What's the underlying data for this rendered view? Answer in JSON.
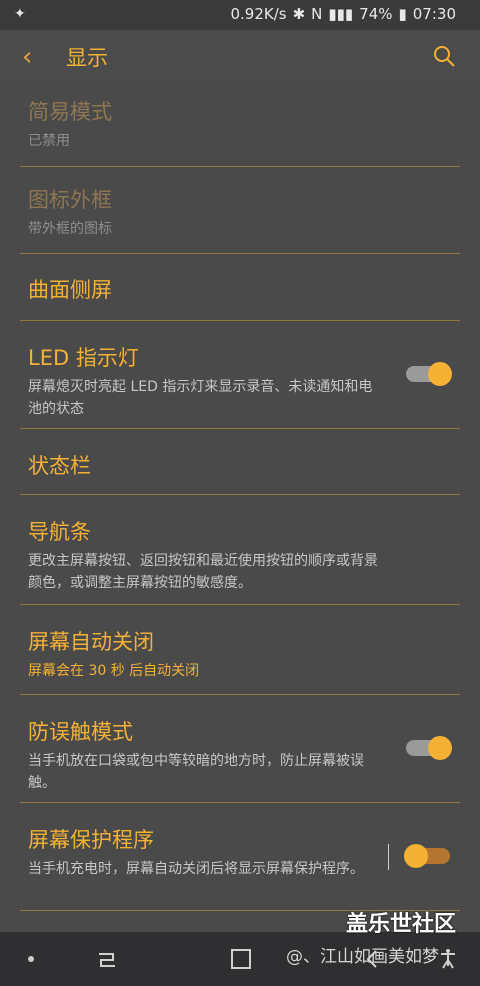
{
  "status_bar": {
    "left_icon": "notification-icon",
    "speed": "0.92K/s",
    "battery": "74%",
    "time": "07:30"
  },
  "app_bar": {
    "back_icon": "chevron-left-icon",
    "title": "显示",
    "search_icon": "search-icon"
  },
  "items": [
    {
      "title": "简易模式",
      "subtitle": "已禁用",
      "enabled": false
    },
    {
      "title": "图标外框",
      "subtitle": "带外框的图标",
      "enabled": false
    },
    {
      "title": "曲面侧屏",
      "subtitle": "",
      "enabled": true
    },
    {
      "title": "LED 指示灯",
      "subtitle": "屏幕熄灭时亮起 LED 指示灯来显示录音、未读通知和电池的状态",
      "enabled": true,
      "toggle": true
    },
    {
      "title": "状态栏",
      "subtitle": "",
      "enabled": true
    },
    {
      "title": "导航条",
      "subtitle": "更改主屏幕按钮、返回按钮和最近使用按钮的顺序或背景颜色，或调整主屏幕按钮的敏感度。",
      "enabled": true
    },
    {
      "title": "屏幕自动关闭",
      "subtitle": "屏幕会在 30 秒 后自动关闭",
      "enabled": true
    },
    {
      "title": "防误触模式",
      "subtitle": "当手机放在口袋或包中等较暗的地方时，防止屏幕被误触。",
      "enabled": true,
      "toggle": true
    },
    {
      "title": "屏幕保护程序",
      "subtitle": "当手机充电时，屏幕自动关闭后将显示屏幕保护程序。",
      "enabled": true,
      "toggle": true
    }
  ],
  "watermark": {
    "title": "盖乐世社区",
    "subtitle": "@、江山如画美如梦"
  },
  "colors": {
    "accent": "#f4b134",
    "background": "#4a4a4b"
  }
}
